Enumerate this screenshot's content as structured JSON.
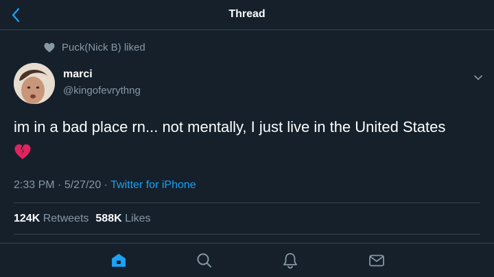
{
  "header": {
    "title": "Thread",
    "back_icon": "chevron-left-icon"
  },
  "social_context": {
    "icon": "heart-icon",
    "text": "Puck(Nick B) liked"
  },
  "tweet": {
    "author_name": "marci",
    "author_handle": "@kingofevrythng",
    "text": "im in a bad place rn... not mentally, I just live in the United States",
    "emoji": "broken-heart-icon",
    "time": "2:33 PM",
    "date": "5/27/20",
    "source": "Twitter for iPhone",
    "retweets_count": "124K",
    "retweets_label": "Retweets",
    "likes_count": "588K",
    "likes_label": "Likes",
    "separator": "·"
  },
  "tabbar": {
    "items": [
      "home-icon",
      "search-icon",
      "notifications-bell-icon",
      "messages-mail-icon"
    ]
  },
  "colors": {
    "background": "#15202b",
    "accent": "#1da1f2",
    "secondary_text": "#8899a6",
    "divider": "#38444d",
    "broken_heart": "#e0245e"
  }
}
